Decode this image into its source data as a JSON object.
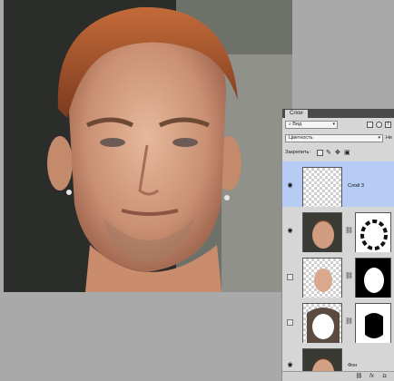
{
  "panel": {
    "tab_label": "Слои",
    "kind_filter": "Вид",
    "blend_mode": "Цветность",
    "opacity_label_partial": "Не",
    "lock_label": "Закрепить:",
    "layers": [
      {
        "name": "Слой 3",
        "visible": true,
        "selected": true,
        "has_mask": false
      },
      {
        "name": "",
        "visible": true,
        "selected": false,
        "has_mask": true
      },
      {
        "name": "",
        "visible": false,
        "selected": false,
        "has_mask": true
      },
      {
        "name": "",
        "visible": false,
        "selected": false,
        "has_mask": true
      },
      {
        "name": "Фон",
        "visible": true,
        "selected": false,
        "has_mask": false
      }
    ],
    "bottom_icons": [
      "link-layers-icon",
      "fx-icon",
      "add-mask-icon"
    ],
    "fx_label": "fx"
  },
  "icons": {
    "eye": "eye-icon",
    "chain": "chain-link-icon",
    "search": "filter-image-icon"
  },
  "colors": {
    "panel_bg": "#d6d6d6",
    "selected_layer": "#b6ccf5",
    "workspace_bg": "#a9a9a9"
  }
}
